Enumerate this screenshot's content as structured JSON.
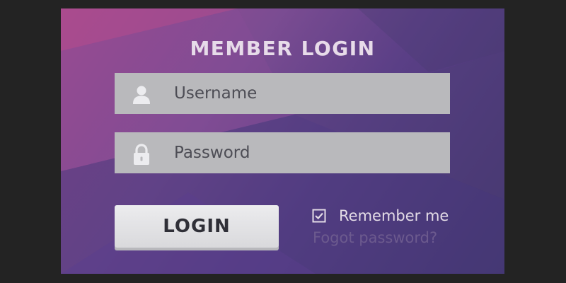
{
  "form": {
    "title": "MEMBER LOGIN",
    "username": {
      "placeholder": "Username",
      "value": "",
      "icon": "user-icon"
    },
    "password": {
      "placeholder": "Password",
      "value": "",
      "icon": "lock-icon"
    },
    "login_label": "LOGIN",
    "remember_label": "Remember me",
    "remember_checked": true,
    "forgot_label": "Fogot password?"
  },
  "colors": {
    "background": "#232323",
    "panel_gradient_start": "#a04a8f",
    "panel_gradient_end": "#3d3468",
    "field_bg": "#b9b9bc",
    "button_bg": "#e2e2e5",
    "link": "#6c5a8e"
  }
}
